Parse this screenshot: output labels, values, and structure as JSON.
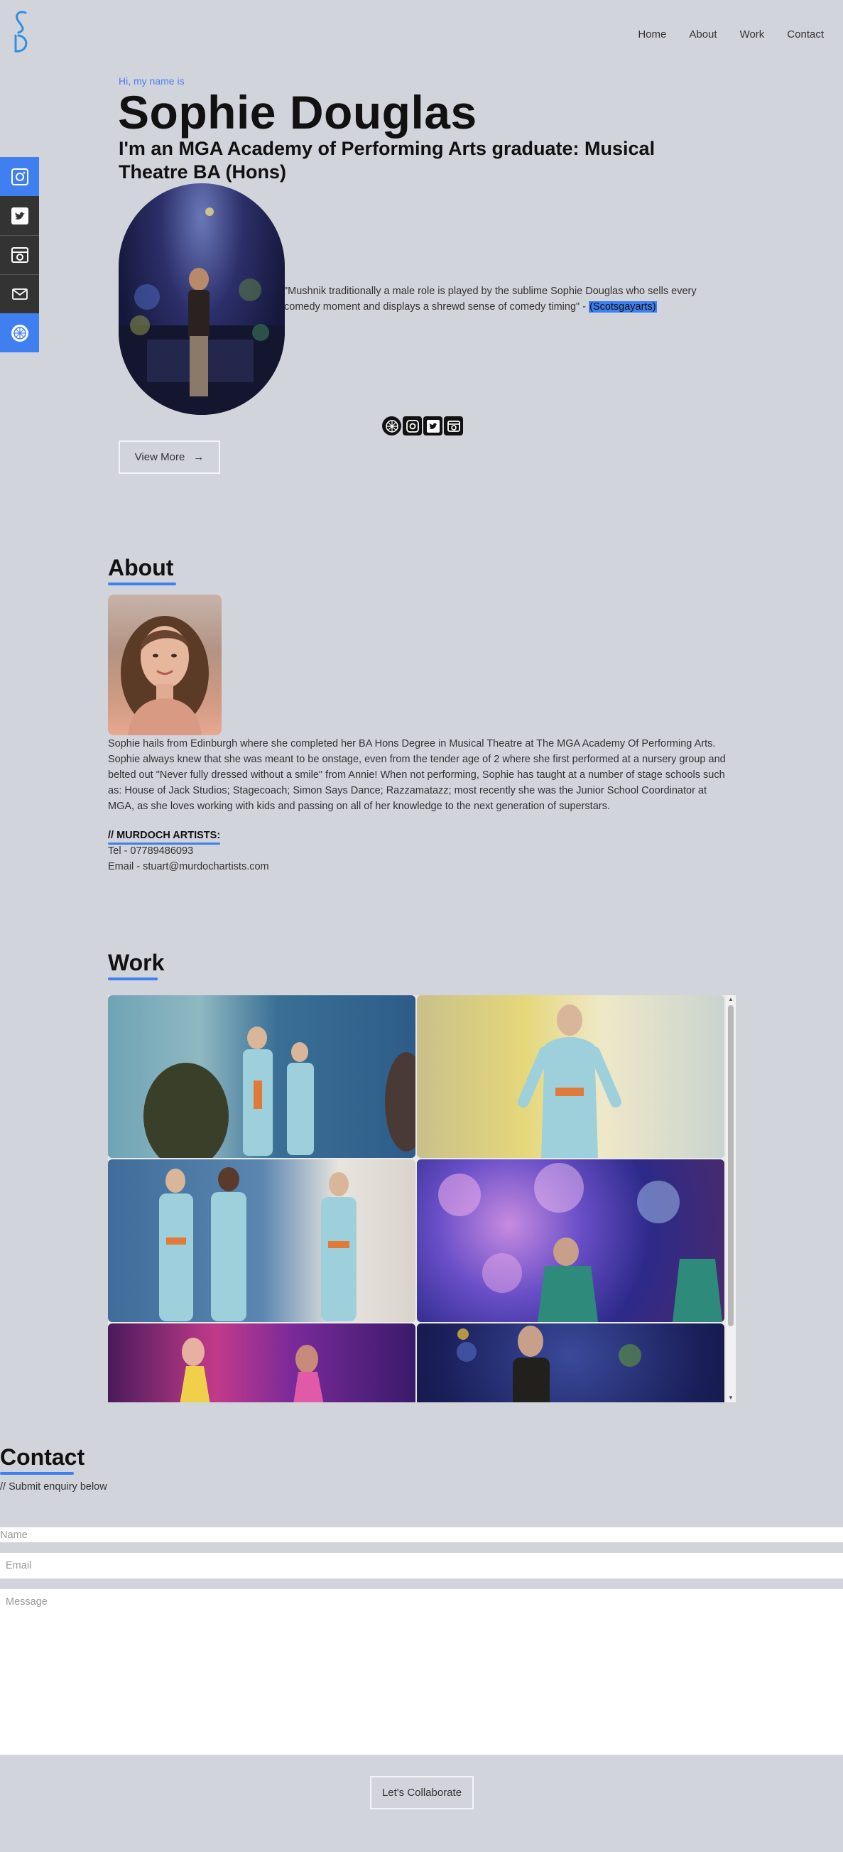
{
  "nav": {
    "items": [
      "Home",
      "About",
      "Work",
      "Contact"
    ]
  },
  "sidebar": {
    "icons": [
      "instagram-icon",
      "twitter-icon",
      "camera-icon",
      "mail-icon",
      "spotlight-icon"
    ]
  },
  "hero": {
    "greeting": "Hi, my name is",
    "name": "Sophie Douglas",
    "tagline": "I'm an MGA Academy of Performing Arts graduate: Musical Theatre BA (Hons)",
    "quote_text": "\"Mushnik traditionally a male role is played by the sublime Sophie Douglas who sells every comedy moment and displays a shrewd sense of comedy timing\" -",
    "quote_source": "(Scotsgayarts)",
    "view_more": "View More",
    "view_more_arrow": "→"
  },
  "about": {
    "heading": "About",
    "bio": "Sophie hails from Edinburgh where she completed her BA Hons Degree in Musical Theatre at The MGA Academy Of Performing Arts. Sophie always knew that she was meant to be onstage, even from the tender age of 2 where she first performed at a nursery group and belted out \"Never fully dressed without a smile\" from Annie! When not performing, Sophie has taught at a number of stage schools such as: House of Jack Studios; Stagecoach; Simon Says Dance; Razzamatazz; most recently she was the Junior School Coordinator at MGA, as she loves working with kids and passing on all of her knowledge to the next generation of superstars.",
    "agency": "// MURDOCH ARTISTS:",
    "tel": "Tel - 07789486093",
    "email": "Email - stuart@murdochartists.com"
  },
  "work": {
    "heading": "Work"
  },
  "contact": {
    "heading": "Contact",
    "note": "// Submit enquiry below",
    "name_placeholder": "Name",
    "email_placeholder": "Email",
    "message_placeholder": "Message",
    "submit": "Let's Collaborate"
  },
  "colors": {
    "background": "#d2d4db",
    "accent": "#3f7ff0",
    "dark": "#333333"
  }
}
